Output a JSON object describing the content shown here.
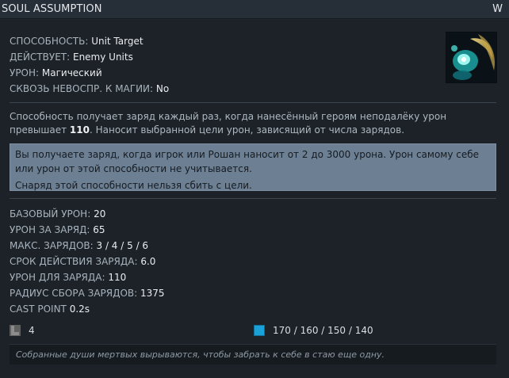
{
  "header": {
    "title": "SOUL ASSUMPTION",
    "hotkey": "W"
  },
  "ability_info": [
    {
      "key": "СПОСОБНОСТЬ:",
      "value": "Unit Target"
    },
    {
      "key": "ДЕЙСТВУЕТ:",
      "value": "Enemy Units"
    },
    {
      "key": "УРОН:",
      "value": "Магический"
    },
    {
      "key": "СКВОЗЬ НЕВОСПР. К МАГИИ:",
      "value": "No"
    }
  ],
  "portrait_icon": "soul-assumption-ability-icon",
  "description": {
    "text_before": "Способность получает заряд каждый раз, когда нанесённый героям неподалёку урон превышает ",
    "highlight": "110",
    "text_after": ". Наносит выбранной цели урон, зависящий от числа зарядов."
  },
  "note": {
    "line1": "Вы получаете заряд, когда игрок или Рошан наносит от 2 до 3000 урона. Урон самому себе или урон от этой способности не учитывается.",
    "line2": "Снаряд этой способности нельзя сбить с цели."
  },
  "values": [
    {
      "key": "БАЗОВЫЙ УРОН:",
      "value": "20"
    },
    {
      "key": "УРОН ЗА ЗАРЯД:",
      "value": "65"
    },
    {
      "key": "МАКС. ЗАРЯДОВ:",
      "value": "3 / 4 / 5 / 6"
    },
    {
      "key": "СРОК ДЕЙСТВИЯ ЗАРЯДА:",
      "value": "6.0"
    },
    {
      "key": "УРОН ДЛЯ ЗАРЯДА:",
      "value": "110"
    },
    {
      "key": "РАДИУС СБОРА ЗАРЯДОВ:",
      "value": "1375"
    },
    {
      "key": "CAST POINT",
      "value": "0.2s"
    }
  ],
  "costs": {
    "cooldown": {
      "icon": "cooldown-icon",
      "value": "4",
      "color": "#6b6b6b"
    },
    "mana": {
      "icon": "mana-icon",
      "value": "170 / 160 / 150 / 140",
      "color": "#1aa2d8"
    }
  },
  "lore": "Собранные души мертвых вырываются, чтобы забрать к себе в стаю еще одну."
}
